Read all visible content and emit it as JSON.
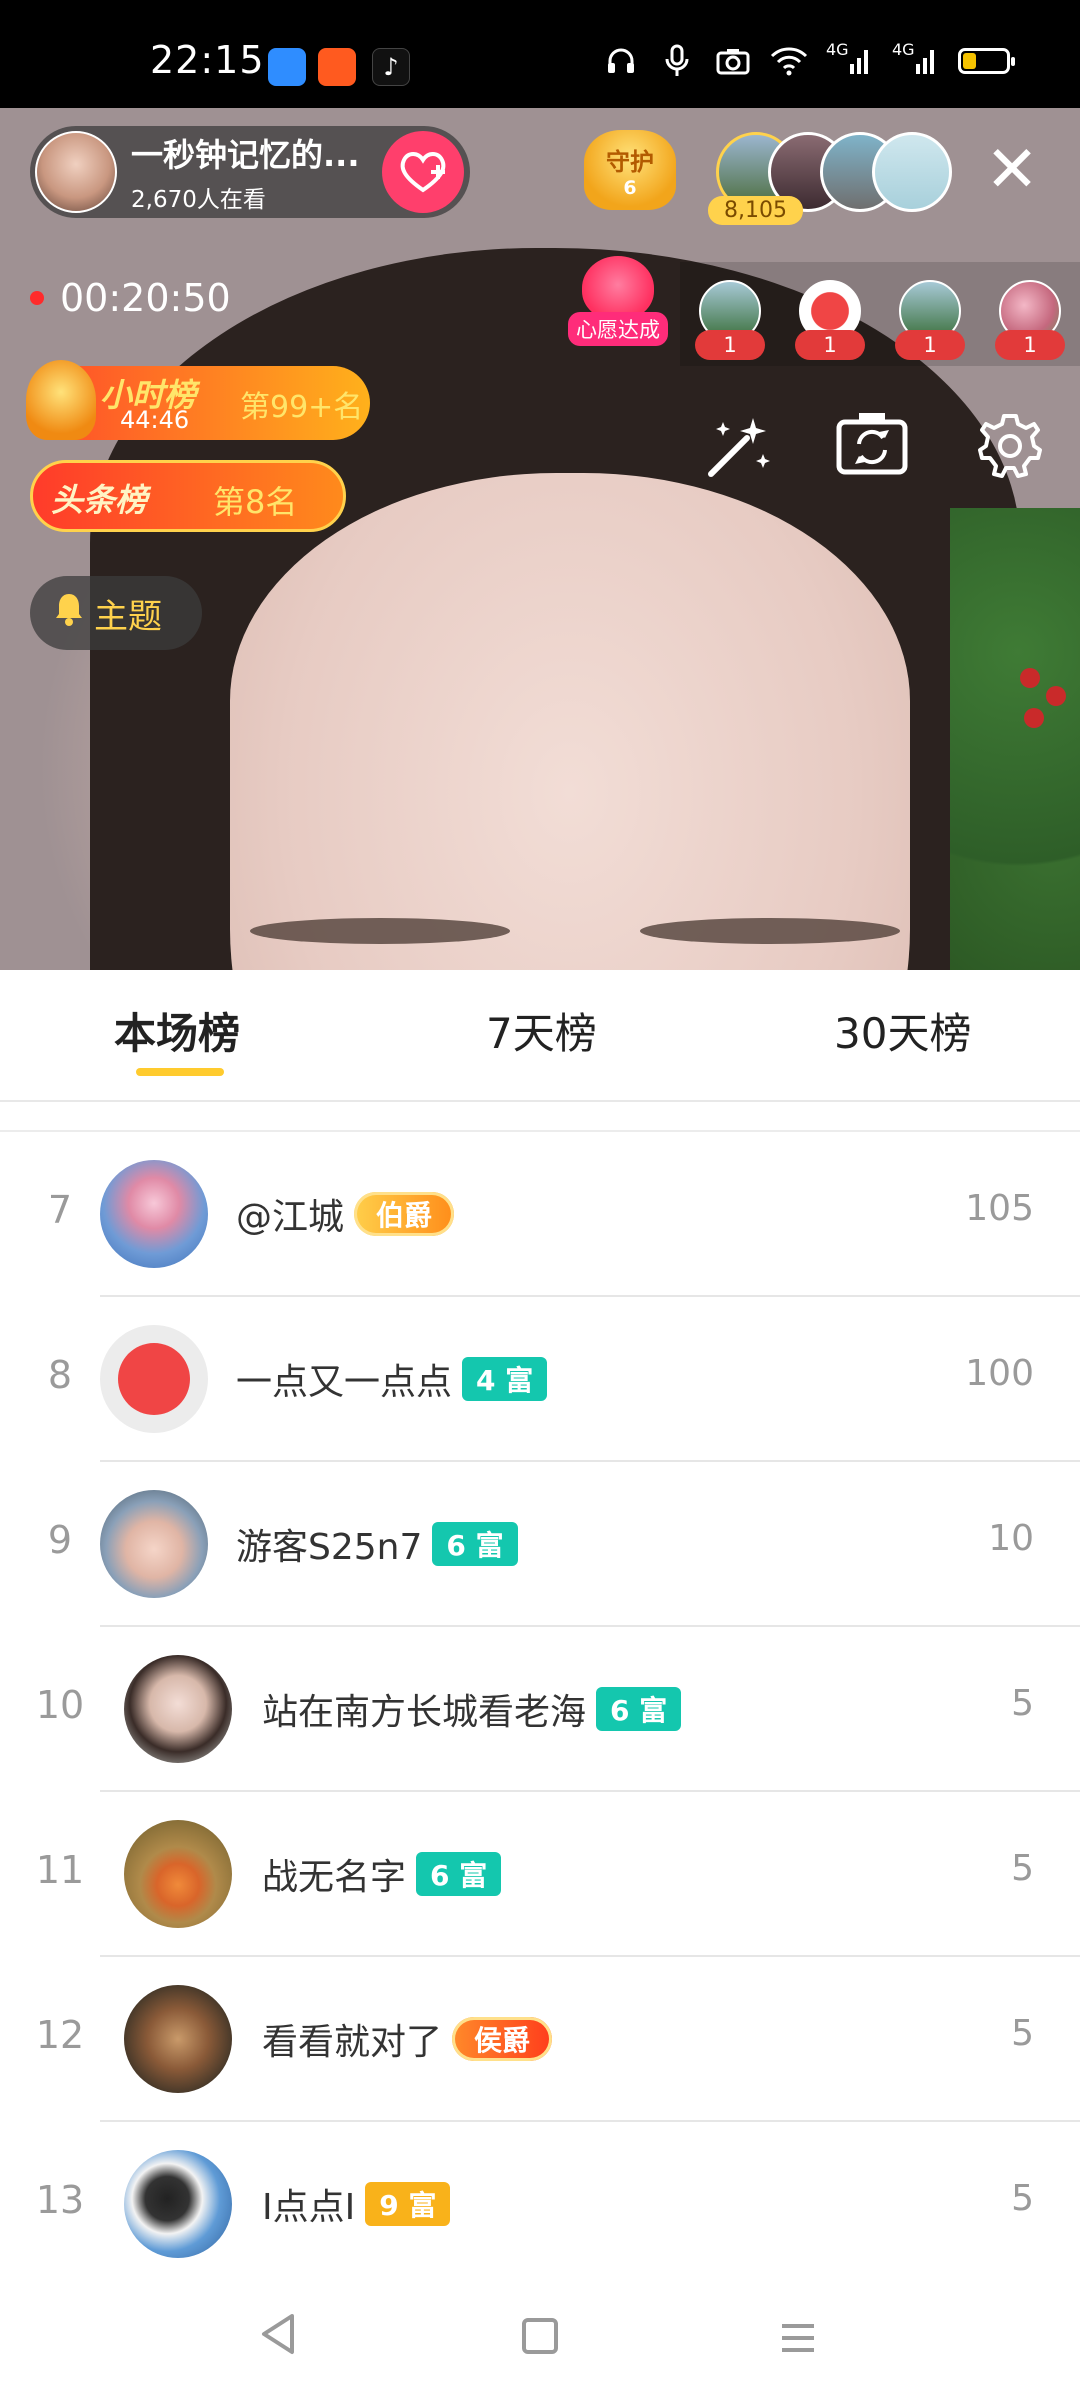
{
  "status_bar": {
    "time": "22:15",
    "signal1": "4G",
    "signal2": "4G",
    "battery_level": 0.3
  },
  "live": {
    "host_name": "一秒钟记忆的...",
    "viewers": "2,670人在看",
    "guard_label": "守护",
    "guard_count": "6",
    "audience_count": "8,105",
    "timer": "00:20:50",
    "wish_label": "心愿达成",
    "gift_counts": [
      "1",
      "1",
      "1",
      "1"
    ],
    "hourly_title": "小时榜",
    "hourly_time": "44:46",
    "hourly_rank": "第99+名",
    "headline_title": "头条榜",
    "headline_rank": "第8名",
    "topic_label": "主题",
    "colors": {
      "accent": "#ffcb2e",
      "follow": "#ff3f6c",
      "teal_badge": "#14c7ae",
      "gold_badge": "#f9b21a"
    }
  },
  "tabs": [
    {
      "label": "本场榜",
      "active": true
    },
    {
      "label": "7天榜",
      "active": false
    },
    {
      "label": "30天榜",
      "active": false
    }
  ],
  "ranking": [
    {
      "rank": "7",
      "name": "@江城",
      "badge": "伯爵",
      "badge_type": "noble",
      "score": "105"
    },
    {
      "rank": "8",
      "name": "一点又一点点",
      "badge": "4 富",
      "badge_type": "teal",
      "score": "100"
    },
    {
      "rank": "9",
      "name": "游客S25n7",
      "badge": "6 富",
      "badge_type": "teal",
      "score": "10"
    },
    {
      "rank": "10",
      "name": "站在南方长城看老海",
      "badge": "6 富",
      "badge_type": "teal",
      "score": "5"
    },
    {
      "rank": "11",
      "name": "战无名字",
      "badge": "6 富",
      "badge_type": "teal",
      "score": "5"
    },
    {
      "rank": "12",
      "name": "看看就对了",
      "badge": "侯爵",
      "badge_type": "noble-red",
      "score": "5"
    },
    {
      "rank": "13",
      "name": "I点点I",
      "badge": "9 富",
      "badge_type": "gold",
      "score": "5"
    }
  ]
}
